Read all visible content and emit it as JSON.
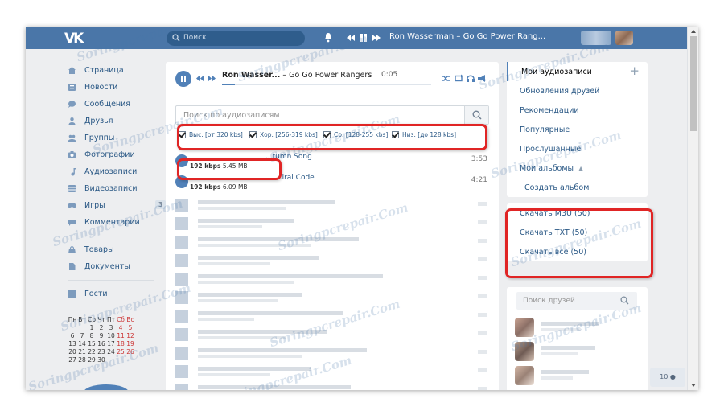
{
  "topbar": {
    "logo": "VK",
    "search_placeholder": "Поиск",
    "now_playing": "Ron Wasserman – Go Go Power Rang..."
  },
  "watermark": "Soringpcrepair.Com",
  "sidebar": {
    "items": [
      {
        "label": "Страница",
        "icon": "home-icon"
      },
      {
        "label": "Новости",
        "icon": "news-icon"
      },
      {
        "label": "Сообщения",
        "icon": "messages-icon"
      },
      {
        "label": "Друзья",
        "icon": "friends-icon"
      },
      {
        "label": "Группы",
        "icon": "groups-icon"
      },
      {
        "label": "Фотографии",
        "icon": "photos-icon"
      },
      {
        "label": "Аудиозаписи",
        "icon": "music-icon"
      },
      {
        "label": "Видеозаписи",
        "icon": "video-icon"
      },
      {
        "label": "Игры",
        "icon": "games-icon",
        "count": "3"
      },
      {
        "label": "Комментарии",
        "icon": "comments-icon"
      }
    ],
    "items2": [
      {
        "label": "Товары",
        "icon": "goods-icon"
      },
      {
        "label": "Документы",
        "icon": "documents-icon"
      }
    ],
    "items3": [
      {
        "label": "Гости",
        "icon": "guests-icon"
      }
    ]
  },
  "calendar": {
    "header": [
      "Пн",
      "Вт",
      "Ср",
      "Чт",
      "Пт",
      "Сб",
      "Вс"
    ],
    "weeks": [
      [
        "",
        "",
        "1",
        "2",
        "3",
        "4",
        "5"
      ],
      [
        "6",
        "7",
        "8",
        "9",
        "10",
        "11",
        "12"
      ],
      [
        "13",
        "14",
        "15",
        "16",
        "17",
        "18",
        "19"
      ],
      [
        "20",
        "21",
        "22",
        "23",
        "24",
        "25",
        "26"
      ],
      [
        "27",
        "28",
        "29",
        "30",
        "",
        "",
        ""
      ]
    ]
  },
  "player": {
    "artist": "Ron Wasser...",
    "title": "– Go Go Power Rangers",
    "time": "0:05",
    "progress": 0.07,
    "volume": 0
  },
  "audio_search": {
    "placeholder": "Поиск по аудиозаписям"
  },
  "quality_filters": [
    {
      "label": "Выс. [от 320 kbs]"
    },
    {
      "label": "Хор. [256-319 kbs]"
    },
    {
      "label": "Ср. [128-255 kbs]"
    },
    {
      "label": "Низ. [до 128 kbs]"
    }
  ],
  "tracks": [
    {
      "title": "...tumn Song",
      "bitrate": "192 kbps",
      "size": "5.45 MB",
      "duration": "3:53"
    },
    {
      "title": "...iral Code",
      "bitrate": "192 kbps",
      "size": "6.09 MB",
      "duration": "4:21"
    }
  ],
  "right_menu": {
    "header": "Мои аудиозаписи",
    "items": [
      "Обновления друзей",
      "Рекомендации",
      "Популярные",
      "Прослушанные",
      "Мои альбомы"
    ],
    "create_album": "Создать альбом"
  },
  "downloads": {
    "items": [
      "Скачать M3U (50)",
      "Скачать TXT (50)",
      "Скачать все (50)"
    ]
  },
  "friends": {
    "placeholder": "Поиск друзей"
  },
  "chat": {
    "count": "10"
  },
  "colors": {
    "header": "#4a76a8",
    "accent": "#5181b8",
    "highlight": "#e02525"
  }
}
